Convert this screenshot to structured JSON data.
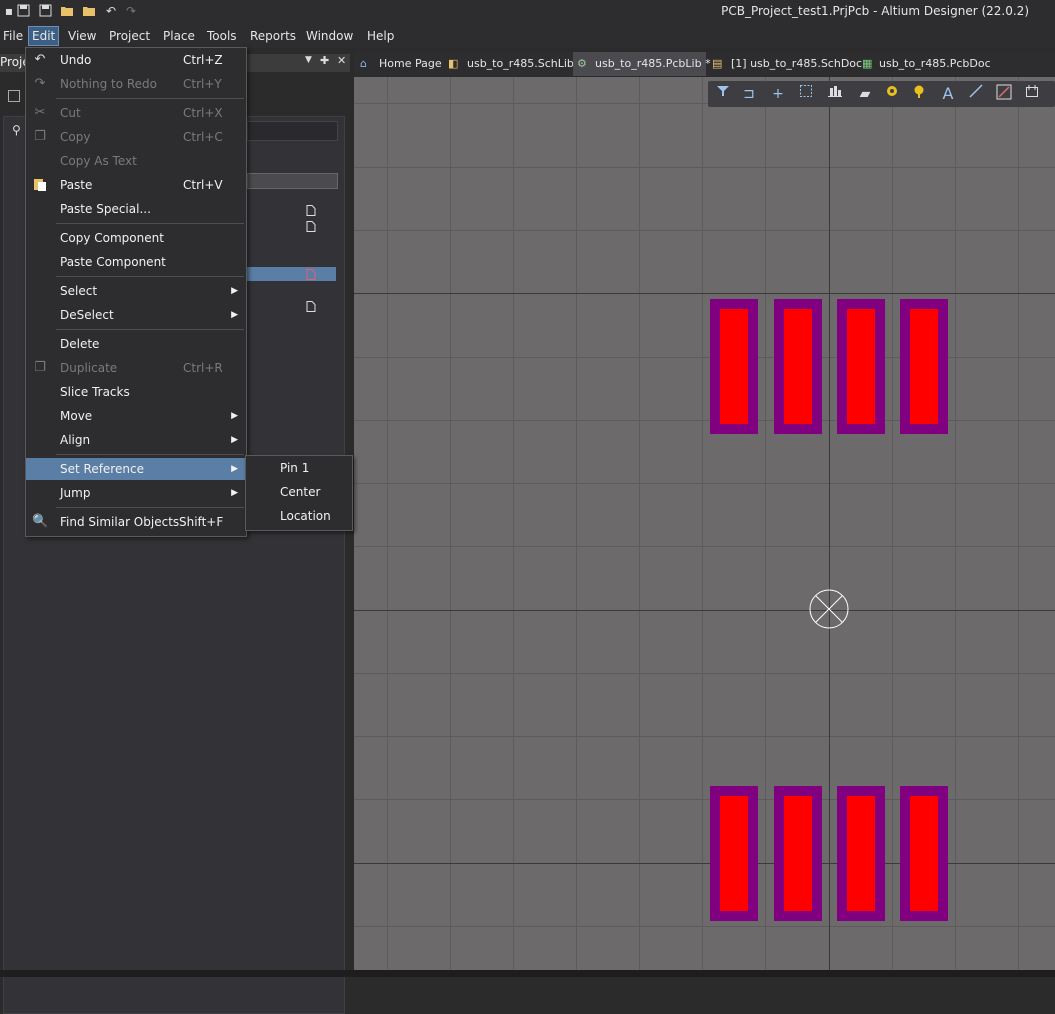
{
  "app": {
    "title": "PCB_Project_test1.PrjPcb - Altium Designer (22.0.2)"
  },
  "menubar": {
    "items": [
      {
        "label": "File"
      },
      {
        "label": "Edit"
      },
      {
        "label": "View"
      },
      {
        "label": "Project"
      },
      {
        "label": "Place"
      },
      {
        "label": "Tools"
      },
      {
        "label": "Reports"
      },
      {
        "label": "Window"
      },
      {
        "label": "Help"
      }
    ]
  },
  "left_panel": {
    "title": "Proje"
  },
  "tabs": [
    {
      "label": "Home Page",
      "icon": "home-icon"
    },
    {
      "label": "usb_to_r485.SchLib",
      "icon": "schlib-icon"
    },
    {
      "label": "usb_to_r485.PcbLib *",
      "icon": "pcblib-icon",
      "active": true
    },
    {
      "label": "[1] usb_to_r485.SchDoc",
      "icon": "schdoc-icon"
    },
    {
      "label": "usb_to_r485.PcbDoc",
      "icon": "pcbdoc-icon"
    }
  ],
  "edit_menu": {
    "items": [
      {
        "label": "Undo",
        "shortcut": "Ctrl+Z",
        "icon": "undo-icon",
        "disabled": false
      },
      {
        "label": "Nothing to Redo",
        "shortcut": "Ctrl+Y",
        "icon": "redo-icon",
        "disabled": true
      },
      {
        "label": "Cut",
        "shortcut": "Ctrl+X",
        "icon": "cut-icon",
        "disabled": true
      },
      {
        "label": "Copy",
        "shortcut": "Ctrl+C",
        "icon": "copy-icon",
        "disabled": true
      },
      {
        "label": "Copy As Text",
        "shortcut": "",
        "disabled": true
      },
      {
        "label": "Paste",
        "shortcut": "Ctrl+V",
        "icon": "paste-icon",
        "disabled": false
      },
      {
        "label": "Paste Special...",
        "shortcut": "",
        "disabled": false
      },
      {
        "label": "Copy Component",
        "shortcut": "",
        "disabled": false
      },
      {
        "label": "Paste Component",
        "shortcut": "",
        "disabled": false
      },
      {
        "label": "Select",
        "submenu": true
      },
      {
        "label": "DeSelect",
        "submenu": true
      },
      {
        "label": "Delete",
        "shortcut": "",
        "disabled": false
      },
      {
        "label": "Duplicate",
        "shortcut": "Ctrl+R",
        "icon": "duplicate-icon",
        "disabled": true
      },
      {
        "label": "Slice Tracks",
        "shortcut": "",
        "disabled": false
      },
      {
        "label": "Move",
        "submenu": true
      },
      {
        "label": "Align",
        "submenu": true
      },
      {
        "label": "Set Reference",
        "submenu": true,
        "highlighted": true
      },
      {
        "label": "Jump",
        "submenu": true
      },
      {
        "label": "Find Similar Objects",
        "shortcut": "Shift+F",
        "icon": "find-icon",
        "disabled": false
      }
    ]
  },
  "set_reference_submenu": {
    "items": [
      {
        "label": "Pin 1"
      },
      {
        "label": "Center"
      },
      {
        "label": "Location"
      }
    ]
  },
  "colors": {
    "pad_outer": "#800080",
    "pad_inner": "#ff0000",
    "canvas": "#6c6a6a",
    "menu_highlight": "#5b7ea6"
  }
}
